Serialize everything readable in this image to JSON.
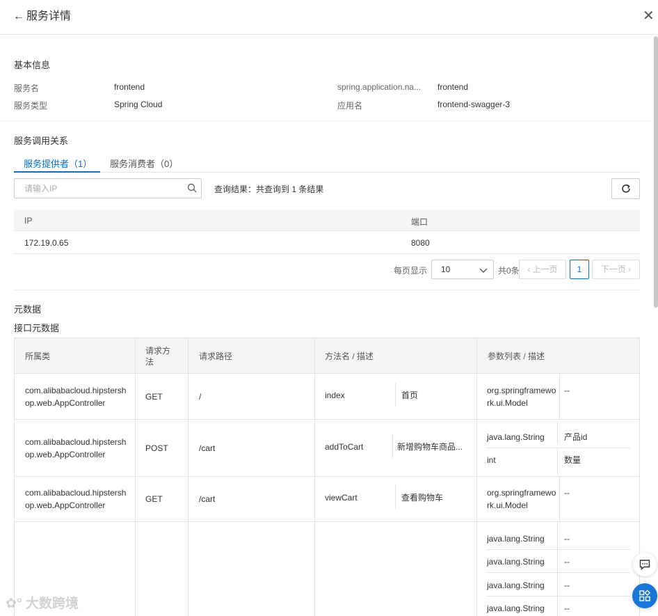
{
  "header": {
    "title": "服务详情"
  },
  "basic": {
    "title": "基本信息",
    "fields": [
      {
        "label": "服务名",
        "value": "frontend"
      },
      {
        "label": "服务类型",
        "value": "Spring Cloud"
      },
      {
        "label": "spring.application.na...",
        "value": "frontend"
      },
      {
        "label": "应用名",
        "value": "frontend-swagger-3"
      }
    ]
  },
  "relations": {
    "title": "服务调用关系",
    "tabs": [
      {
        "label": "服务提供者（1）"
      },
      {
        "label": "服务消费者（0）"
      }
    ],
    "search_placeholder": "请输入IP",
    "query_result": "查询结果：共查询到 1 条结果",
    "columns": [
      "IP",
      "端口"
    ],
    "rows": [
      {
        "ip": "172.19.0.65",
        "port": "8080"
      }
    ],
    "pager": {
      "page_size_label": "每页显示",
      "page_size": "10",
      "total": "共0条",
      "prev": "上一页",
      "next": "下一页",
      "current_page": "1"
    }
  },
  "metadata": {
    "title": "元数据",
    "subtitle": "接口元数据",
    "columns": [
      "所属类",
      "请求方\n法",
      "请求路径",
      "方法名 / 描述",
      "参数列表 / 描述"
    ],
    "rows": [
      {
        "class": "com.alibabacloud.hipstershop.web.AppController",
        "method": "GET",
        "path": "/",
        "name": "index",
        "desc": "首页",
        "params": [
          {
            "type": "org.springframework.ui.Model",
            "desc": "--"
          }
        ]
      },
      {
        "class": "com.alibabacloud.hipstershop.web.AppController",
        "method": "POST",
        "path": "/cart",
        "name": "addToCart",
        "desc": "新增购物车商品...",
        "params": [
          {
            "type": "java.lang.String",
            "desc": "产品id"
          },
          {
            "type": "int",
            "desc": "数量"
          }
        ]
      },
      {
        "class": "com.alibabacloud.hipstershop.web.AppController",
        "method": "GET",
        "path": "/cart",
        "name": "viewCart",
        "desc": "查看购物车",
        "params": [
          {
            "type": "org.springframework.ui.Model",
            "desc": "--"
          }
        ]
      },
      {
        "class": "",
        "method": "",
        "path": "",
        "name": "",
        "desc": "",
        "params": [
          {
            "type": "java.lang.String",
            "desc": "--"
          },
          {
            "type": "java.lang.String",
            "desc": "--"
          },
          {
            "type": "java.lang.String",
            "desc": "--"
          },
          {
            "type": "java.lang.String",
            "desc": "--"
          }
        ]
      }
    ]
  },
  "watermark": "大数跨境",
  "colors": {
    "accent": "#0070cc",
    "float_button": "#1677d9"
  }
}
